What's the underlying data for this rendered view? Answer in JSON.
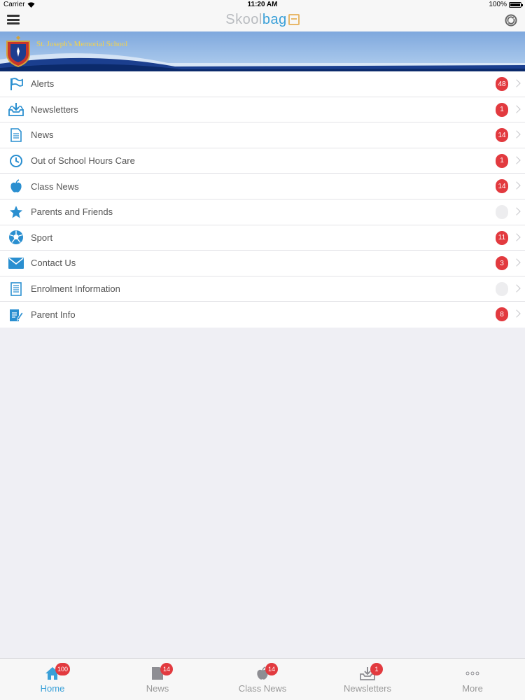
{
  "status_bar": {
    "carrier": "Carrier",
    "time": "11:20 AM",
    "battery": "100%"
  },
  "nav": {
    "logo_part1": "Skool",
    "logo_part2": "bag"
  },
  "banner": {
    "school_name": "St. Joseph's Memorial School"
  },
  "menu": {
    "items": [
      {
        "label": "Alerts",
        "badge": "48",
        "icon": "flag-icon"
      },
      {
        "label": "Newsletters",
        "badge": "1",
        "icon": "inbox-download-icon"
      },
      {
        "label": "News",
        "badge": "14",
        "icon": "document-icon"
      },
      {
        "label": "Out of School Hours Care",
        "badge": "1",
        "icon": "clock-icon"
      },
      {
        "label": "Class News",
        "badge": "14",
        "icon": "apple-icon"
      },
      {
        "label": "Parents and Friends",
        "badge": "",
        "icon": "star-icon"
      },
      {
        "label": "Sport",
        "badge": "11",
        "icon": "soccer-ball-icon"
      },
      {
        "label": "Contact Us",
        "badge": "3",
        "icon": "envelope-icon"
      },
      {
        "label": "Enrolment Information",
        "badge": "",
        "icon": "list-document-icon"
      },
      {
        "label": "Parent Info",
        "badge": "8",
        "icon": "edit-document-icon"
      }
    ]
  },
  "tabs": [
    {
      "label": "Home",
      "badge": "100",
      "icon": "home-icon"
    },
    {
      "label": "News",
      "badge": "14",
      "icon": "document-icon"
    },
    {
      "label": "Class News",
      "badge": "14",
      "icon": "apple-icon"
    },
    {
      "label": "Newsletters",
      "badge": "1",
      "icon": "inbox-download-icon"
    },
    {
      "label": "More",
      "badge": "",
      "icon": "more-dots-icon"
    }
  ],
  "colors": {
    "accent": "#3aa0d8",
    "badge": "#e23a3f",
    "banner": "#7fa8dd",
    "school_name": "#f4d24a"
  }
}
